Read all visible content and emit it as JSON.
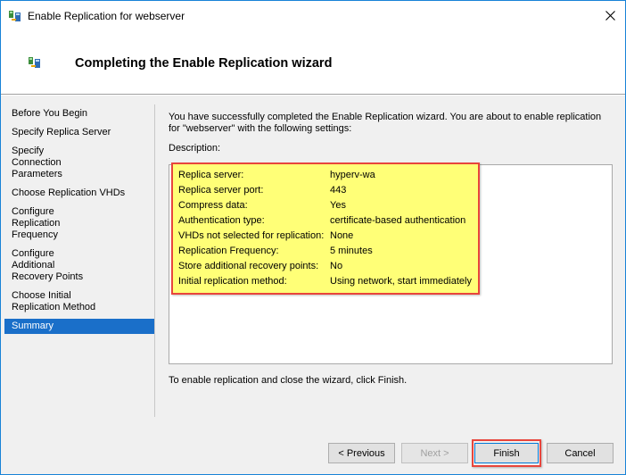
{
  "window": {
    "title": "Enable Replication for webserver"
  },
  "header": {
    "title": "Completing the Enable Replication wizard"
  },
  "nav": {
    "items": [
      "Before You Begin",
      "Specify Replica Server",
      "Specify Connection Parameters",
      "Choose Replication VHDs",
      "Configure Replication Frequency",
      "Configure Additional Recovery Points",
      "Choose Initial Replication Method",
      "Summary"
    ],
    "selected": "Summary"
  },
  "main": {
    "intro": "You have successfully completed the Enable Replication wizard. You are about to enable replication for \"webserver\" with the following settings:",
    "description_label": "Description:",
    "settings": [
      {
        "key": "Replica server:",
        "value": "hyperv-wa"
      },
      {
        "key": "Replica server port:",
        "value": "443"
      },
      {
        "key": "Compress data:",
        "value": "Yes"
      },
      {
        "key": "Authentication type:",
        "value": "certificate-based authentication"
      },
      {
        "key": "VHDs not selected for replication:",
        "value": "None"
      },
      {
        "key": "Replication Frequency:",
        "value": "5 minutes"
      },
      {
        "key": "Store additional recovery points:",
        "value": "No"
      },
      {
        "key": "Initial replication method:",
        "value": "Using network, start immediately"
      }
    ],
    "outro": "To enable replication and close the wizard, click Finish."
  },
  "footer": {
    "previous": "< Previous",
    "next": "Next >",
    "finish": "Finish",
    "cancel": "Cancel"
  },
  "colors": {
    "highlight_fill": "#ffff77",
    "highlight_border": "#e8453c",
    "selection": "#1a6fc9"
  }
}
